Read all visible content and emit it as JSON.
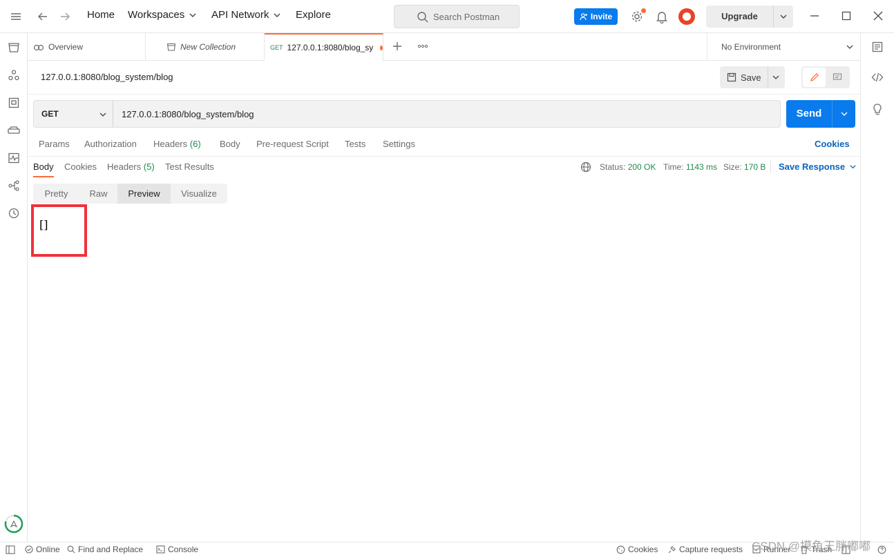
{
  "topbar": {
    "nav": [
      "Home",
      "Workspaces",
      "API Network",
      "Explore"
    ],
    "search_placeholder": "Search Postman",
    "invite_label": "Invite",
    "upgrade_label": "Upgrade"
  },
  "tabs": [
    {
      "label": "Overview"
    },
    {
      "label": "New Collection"
    },
    {
      "method": "GET",
      "label": "127.0.0.1:8080/blog_sy"
    }
  ],
  "environment": "No Environment",
  "request": {
    "title": "127.0.0.1:8080/blog_system/blog",
    "save_label": "Save",
    "method": "GET",
    "url": "127.0.0.1:8080/blog_system/blog",
    "send_label": "Send"
  },
  "request_tabs": {
    "params": "Params",
    "authorization": "Authorization",
    "headers": "Headers",
    "headers_count": "(6)",
    "body": "Body",
    "prerequest": "Pre-request Script",
    "tests": "Tests",
    "settings": "Settings",
    "cookies": "Cookies"
  },
  "response_tabs": {
    "body": "Body",
    "cookies": "Cookies",
    "headers": "Headers",
    "headers_count": "(5)",
    "test_results": "Test Results"
  },
  "response_meta": {
    "status_label": "Status:",
    "status_value": "200 OK",
    "time_label": "Time:",
    "time_value": "1143 ms",
    "size_label": "Size:",
    "size_value": "170 B",
    "save_response": "Save Response"
  },
  "view_modes": [
    "Pretty",
    "Raw",
    "Preview",
    "Visualize"
  ],
  "preview_body": "[]",
  "statusbar": {
    "online": "Online",
    "find_replace": "Find and Replace",
    "console": "Console",
    "cookies": "Cookies",
    "capture": "Capture requests",
    "runner": "Runner",
    "trash": "Trash"
  },
  "watermark": "CSDN @摸鱼王胖嘟嘟",
  "colors": {
    "accent_orange": "#ff6c37",
    "primary_blue": "#097bed",
    "status_green": "#1f8a4c",
    "highlight_red": "#f0303a"
  }
}
